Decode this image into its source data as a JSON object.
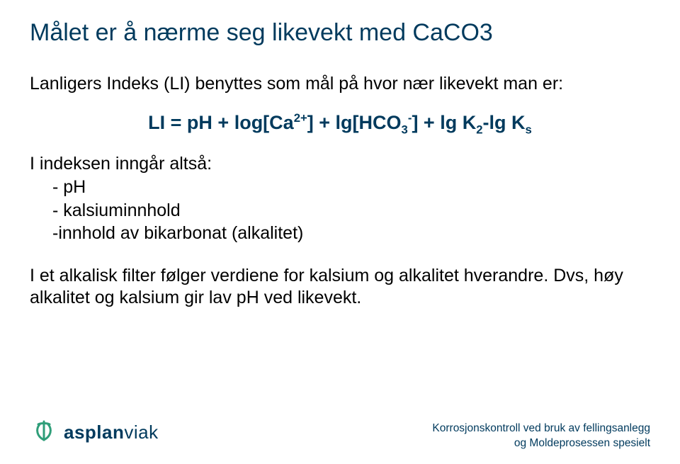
{
  "title": "Målet er å nærme seg likevekt med CaCO3",
  "intro": "Lanligers Indeks (LI) benyttes som mål på hvor nær likevekt man er:",
  "formula": {
    "prefix": "LI = pH + log[Ca",
    "sup1": "2+",
    "mid1": "] + lg[HCO",
    "sub3": "3",
    "supminus": "-",
    "mid2": "] + lg K",
    "sub2": "2",
    "mid3": "-lg K",
    "subS": "s"
  },
  "list_intro": "I indeksen inngår altså:",
  "bullets": {
    "b1": "- pH",
    "b2": "- kalsiuminnhold",
    "b3": "-innhold av bikarbonat (alkalitet)"
  },
  "body1": "I et alkalisk filter følger verdiene for kalsium og alkalitet hverandre. Dvs, høy alkalitet og kalsium gir lav pH ved likevekt.",
  "footer": {
    "line1": "Korrosjonskontroll ved bruk av fellingsanlegg",
    "line2": "og Moldeprosessen spesielt"
  },
  "logo": {
    "bold": "asplan",
    "light": "viak"
  }
}
